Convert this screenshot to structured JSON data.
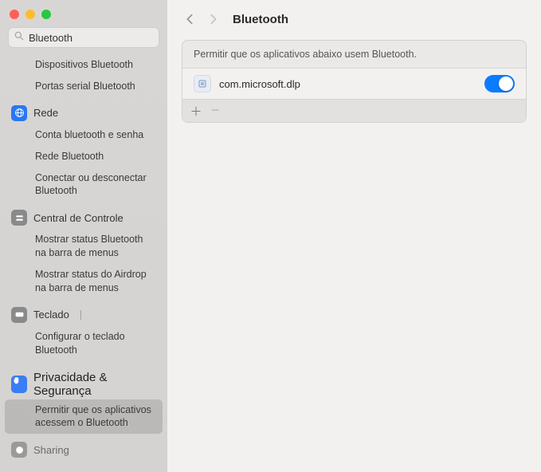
{
  "search": {
    "value": "Bluetooth"
  },
  "sidebar": {
    "items_top": [
      "Dispositivos Bluetooth",
      "Portas serial Bluetooth"
    ],
    "rede": {
      "label": "Rede",
      "items": [
        "Conta bluetooth e senha",
        "Rede Bluetooth",
        "Conectar ou desconectar Bluetooth"
      ]
    },
    "controle": {
      "label": "Central de Controle",
      "items": [
        "Mostrar status Bluetooth na barra de menus",
        "Mostrar status do Airdrop na barra de menus"
      ]
    },
    "teclado": {
      "label": "Teclado",
      "items": [
        "Configurar o teclado Bluetooth"
      ]
    },
    "privacy": {
      "label": "Privacidade &amp; Segurança",
      "items": [
        "Permitir que os aplicativos acessem o Bluetooth"
      ]
    },
    "sharing": {
      "label": "Sharing"
    }
  },
  "main": {
    "title": "Bluetooth",
    "caption": "Permitir que os aplicativos abaixo usem Bluetooth.",
    "apps": [
      {
        "name": "com.microsoft.dlp",
        "enabled": true
      }
    ]
  }
}
